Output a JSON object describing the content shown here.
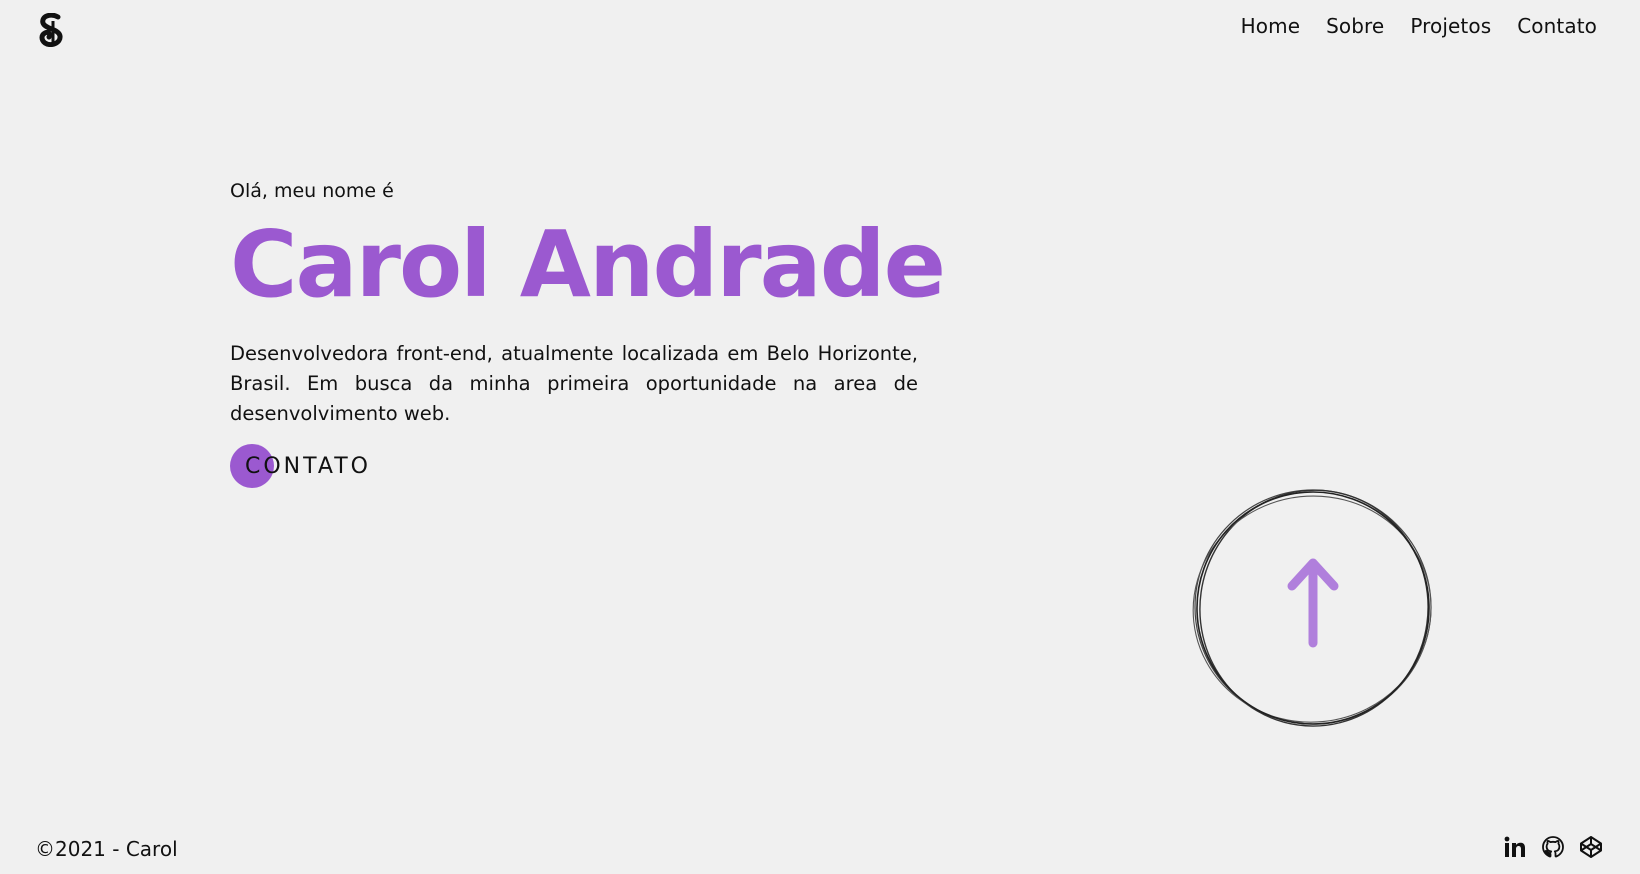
{
  "header": {
    "logo_icon": "script-s-logo-icon",
    "nav": [
      {
        "label": "Home"
      },
      {
        "label": "Sobre"
      },
      {
        "label": "Projetos"
      },
      {
        "label": "Contato"
      }
    ]
  },
  "hero": {
    "greeting": "Olá, meu nome é",
    "name": "Carol Andrade",
    "description": "Desenvolvedora front-end, atualmente localizada em Belo Horizonte, Brasil. Em busca da minha primeira oportunidade na area de desenvolvimento web.",
    "cta_label": "CONTATO"
  },
  "scroll_button": {
    "icon": "arrow-up-icon"
  },
  "footer": {
    "copyright": "©2021 - Carol",
    "socials": [
      {
        "icon": "linkedin-icon"
      },
      {
        "icon": "github-icon"
      },
      {
        "icon": "codepen-icon"
      }
    ]
  },
  "colors": {
    "background": "#f0f0f0",
    "accent": "#9b59d0",
    "arrow": "#b07fdc",
    "text": "#111111"
  }
}
